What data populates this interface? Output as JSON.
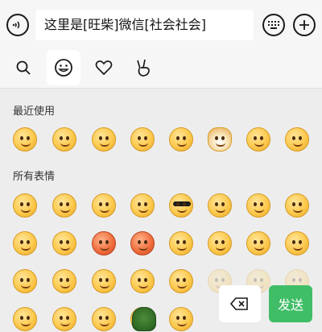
{
  "input_bar": {
    "voice_icon": "voice-icon",
    "message_text": "这里是[旺柴]微信[社会社会]",
    "keyboard_icon": "keyboard-icon",
    "plus_icon": "plus-icon"
  },
  "tabs": [
    {
      "icon": "search-icon",
      "selected": false
    },
    {
      "icon": "smiley-icon",
      "selected": true
    },
    {
      "icon": "heart-icon",
      "selected": false
    },
    {
      "icon": "victory-hand-icon",
      "selected": false
    }
  ],
  "recent": {
    "title": "最近使用",
    "emojis": [
      "slight-smile",
      "grin",
      "tongue-out",
      "laugh-tears",
      "hiding-giggle",
      "wang-chai-doge",
      "smirk",
      "covering-mouth"
    ]
  },
  "all": {
    "title": "所有表情",
    "rows": [
      [
        "smile",
        "confused",
        "heart-eyes",
        "stare",
        "sunglasses",
        "crying-bitter",
        "shy",
        "sealed-lips"
      ],
      [
        "sleepy",
        "scared",
        "angry-red",
        "furious",
        "tongue-wink",
        "big-grin",
        "surprised",
        "sad"
      ],
      [
        "blink",
        "teary-laugh",
        "tired",
        "pondering",
        "clever-smile",
        "faded-1",
        "faded-2",
        "faded-3"
      ],
      [
        "stunned",
        "awkward",
        "sweating",
        "speechless",
        "turtle",
        "headband",
        "faded-4",
        "faded-5"
      ]
    ]
  },
  "actions": {
    "backspace_icon": "backspace-icon",
    "send_label": "发送",
    "send_color": "#3fbd67"
  }
}
